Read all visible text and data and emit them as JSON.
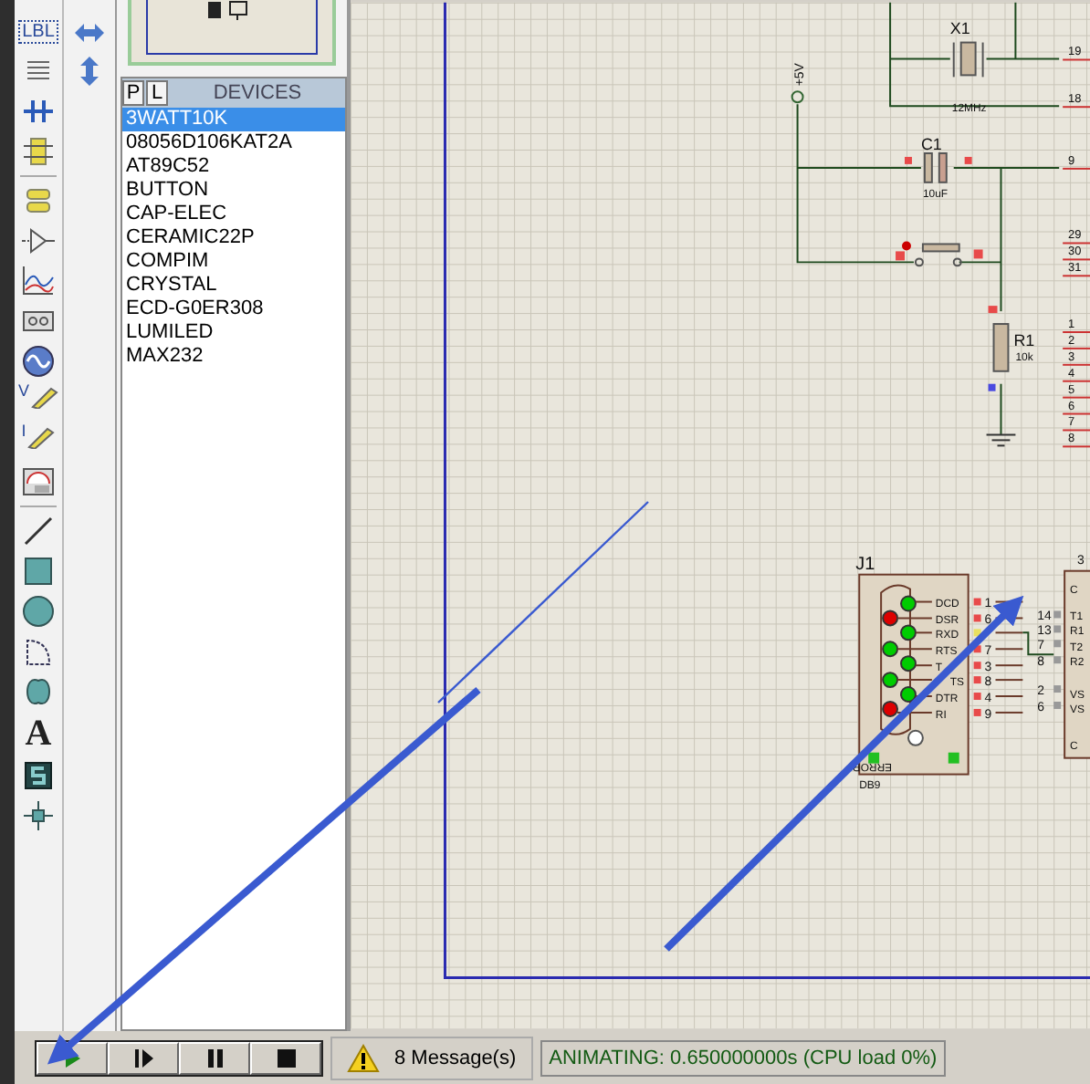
{
  "toolbar": {
    "tools": [
      {
        "kind": "label",
        "glyph": "LBL"
      },
      {
        "kind": "script"
      },
      {
        "kind": "bus"
      },
      {
        "kind": "subcircuit"
      },
      {
        "kind": "terminal"
      },
      {
        "kind": "pin"
      },
      {
        "kind": "graph"
      },
      {
        "kind": "tape"
      },
      {
        "kind": "generator"
      },
      {
        "kind": "voltage-probe",
        "glyph": "V"
      },
      {
        "kind": "current-probe",
        "glyph": "I"
      },
      {
        "kind": "instrument"
      },
      {
        "kind": "line"
      },
      {
        "kind": "box"
      },
      {
        "kind": "circle"
      },
      {
        "kind": "arc"
      },
      {
        "kind": "path"
      },
      {
        "kind": "text",
        "glyph": "A"
      },
      {
        "kind": "symbol"
      },
      {
        "kind": "marker"
      }
    ],
    "rotate_tools": [
      {
        "kind": "horizontal"
      },
      {
        "kind": "vertical"
      }
    ]
  },
  "device_panel": {
    "tabs": [
      {
        "label": "P"
      },
      {
        "label": "L"
      }
    ],
    "title": "DEVICES",
    "devices": [
      {
        "name": "3WATT10K",
        "selected": true
      },
      {
        "name": "08056D106KAT2A",
        "selected": false
      },
      {
        "name": "AT89C52",
        "selected": false
      },
      {
        "name": "BUTTON",
        "selected": false
      },
      {
        "name": "CAP-ELEC",
        "selected": false
      },
      {
        "name": "CERAMIC22P",
        "selected": false
      },
      {
        "name": "COMPIM",
        "selected": false
      },
      {
        "name": "CRYSTAL",
        "selected": false
      },
      {
        "name": "ECD-G0ER308",
        "selected": false
      },
      {
        "name": "LUMILED",
        "selected": false
      },
      {
        "name": "MAX232",
        "selected": false
      }
    ]
  },
  "schematic": {
    "power_label": "+5V",
    "components": [
      {
        "ref": "X1",
        "value": "12MHz"
      },
      {
        "ref": "C1",
        "value": "10uF"
      },
      {
        "ref": "R1",
        "value": "10k"
      },
      {
        "ref": "J1",
        "value": "DB9"
      }
    ],
    "mcu_pins": [
      "19",
      "18",
      "9",
      "29",
      "30",
      "31",
      "1",
      "2",
      "3",
      "4",
      "5",
      "6",
      "7",
      "8"
    ],
    "connector_pins": [
      {
        "name": "DCD",
        "number": "1",
        "color": "#00cc00"
      },
      {
        "name": "DSR",
        "number": "6",
        "color": "#dd0000"
      },
      {
        "name": "RXD",
        "color": "#00cc00"
      },
      {
        "name": "RTS",
        "number": "7",
        "color": "#00cc00"
      },
      {
        "name": "T",
        "number": "3",
        "color": "#00cc00"
      },
      {
        "name": "TS",
        "number": "8",
        "color": "#00cc00"
      },
      {
        "name": "DTR",
        "number": "4",
        "color": "#00cc00"
      },
      {
        "name": "RI",
        "number": "9",
        "color": "#dd0000"
      }
    ],
    "connector_error_label": "ERROR",
    "driver_ref": "3",
    "driver_pins": [
      "14",
      "13",
      "7",
      "8",
      "2",
      "6"
    ],
    "driver_inner": [
      "C",
      "T1",
      "R1",
      "T2",
      "R2",
      "VS",
      "VS",
      "C"
    ]
  },
  "sim_controls": [
    {
      "kind": "play"
    },
    {
      "kind": "step"
    },
    {
      "kind": "pause"
    },
    {
      "kind": "stop"
    }
  ],
  "messages": "8 Message(s)",
  "status": "ANIMATING: 0.650000000s (CPU load 0%)"
}
